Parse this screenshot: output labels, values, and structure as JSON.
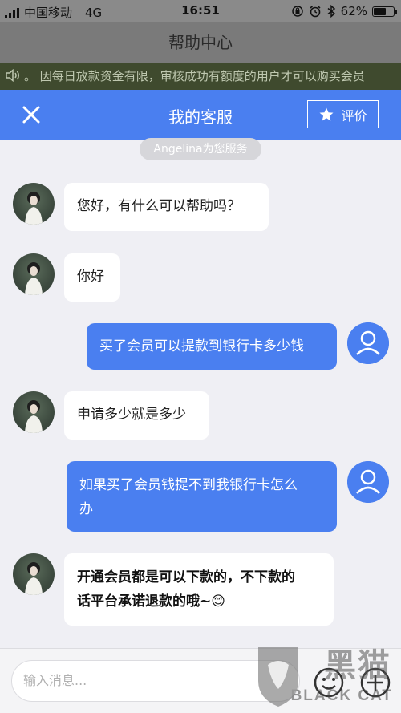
{
  "status_bar": {
    "carrier": "中国移动",
    "network": "4G",
    "time": "16:51",
    "battery": "62%",
    "battery_level": 0.62
  },
  "help_header": {
    "title": "帮助中心"
  },
  "notice": {
    "text": "。 因每日放款资金有限，审核成功有额度的用户才可以购买会员"
  },
  "chat_header": {
    "title": "我的客服",
    "rate_label": "评价"
  },
  "service_pill": {
    "text": "Angelina为您服务"
  },
  "messages": [
    {
      "sender": "agent",
      "text": "您好，有什么可以帮助吗？"
    },
    {
      "sender": "agent",
      "text": "你好"
    },
    {
      "sender": "user",
      "text": "买了会员可以提款到银行卡多少钱"
    },
    {
      "sender": "agent",
      "text": "申请多少就是多少"
    },
    {
      "sender": "user",
      "line1": "如果买了会员钱提不到我银行卡怎么",
      "line2": "办"
    },
    {
      "sender": "agent",
      "line1": "开通会员都是可以下款的，不下款的",
      "line2": "话平台承诺退款的哦~",
      "emoji": "😊"
    }
  ],
  "input_bar": {
    "placeholder": "输入消息..."
  },
  "watermark": {
    "cn": "黑猫",
    "en": "BLACK CAT"
  },
  "colors": {
    "accent": "#4a7ff0",
    "chat_bg": "#efeff4"
  },
  "icons": [
    "signal-icon",
    "lock-rotation-icon",
    "alarm-icon",
    "bluetooth-icon",
    "battery-icon",
    "speaker-icon",
    "close-icon",
    "star-icon",
    "user-avatar-icon",
    "emoji-icon",
    "plus-icon"
  ]
}
